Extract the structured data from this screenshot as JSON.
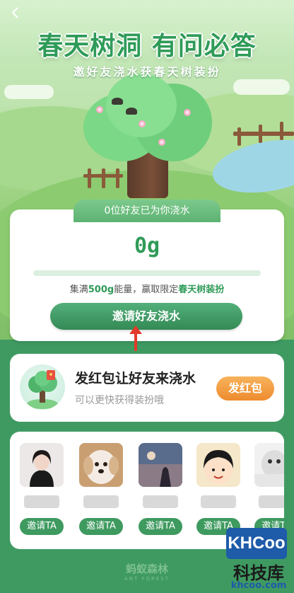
{
  "header": {
    "back_icon": "chevron-left-icon",
    "title": "春天树洞 有问必答",
    "subtitle": "邀好友浇水获春天树装扮"
  },
  "watering": {
    "friends_watered_text": "0位好友已为你浇水",
    "amount": "0g",
    "progress_fraction": 0,
    "goal_prefix": "集满",
    "goal_amount": "500g",
    "goal_middle": "能量，赢取限定",
    "goal_reward": "春天树装扮",
    "invite_button": "邀请好友浇水"
  },
  "red_packet": {
    "title": "发红包让好友来浇水",
    "description": "可以更快获得装扮哦",
    "button": "发红包"
  },
  "friends": {
    "invite_label": "邀请TA",
    "items": [
      {
        "avatar": "person-photo"
      },
      {
        "avatar": "dog-photo"
      },
      {
        "avatar": "landscape-photo"
      },
      {
        "avatar": "cartoon-photo"
      },
      {
        "avatar": "meme-photo"
      }
    ]
  },
  "footer": {
    "brand": "蚂蚁森林",
    "brand_en": "ANT FOREST"
  },
  "watermark": {
    "logo_text": "KHCoo",
    "name": "科技库",
    "url": "khcoo.com"
  },
  "colors": {
    "brand_green": "#3e9a5f",
    "title_green": "#2f9b58",
    "packet_orange": "#ee8b2e",
    "arrow_red": "#e23a2a"
  }
}
